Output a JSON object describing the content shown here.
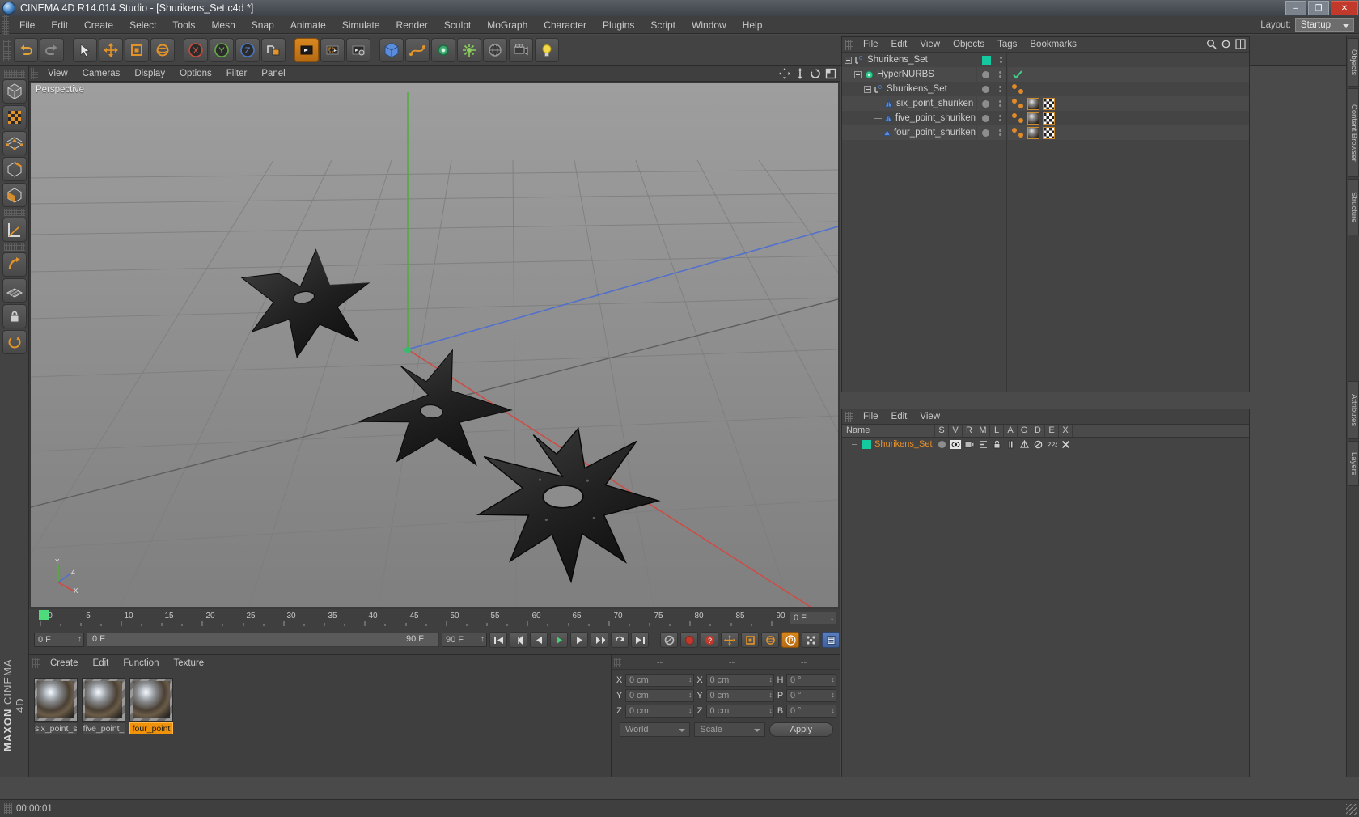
{
  "window": {
    "title": "CINEMA 4D R14.014 Studio - [Shurikens_Set.c4d *]",
    "app_icon": "c4d-logo-icon",
    "minimize": "–",
    "maximize": "❐",
    "close": "✕"
  },
  "menubar": {
    "items": [
      "File",
      "Edit",
      "Create",
      "Select",
      "Tools",
      "Mesh",
      "Snap",
      "Animate",
      "Simulate",
      "Render",
      "Sculpt",
      "MoGraph",
      "Character",
      "Plugins",
      "Script",
      "Window",
      "Help"
    ],
    "layout_label": "Layout:",
    "layout_value": "Startup"
  },
  "toolbar": {
    "buttons": [
      {
        "name": "undo-button",
        "icon": "undo-arrow-icon"
      },
      {
        "name": "redo-button",
        "icon": "redo-arrow-icon"
      },
      {
        "name": "live-selection-button",
        "icon": "cursor-arrow-icon"
      },
      {
        "name": "move-button",
        "icon": "move-cross-icon"
      },
      {
        "name": "scale-button",
        "icon": "scale-square-icon"
      },
      {
        "name": "rotate-button",
        "icon": "rotate-circle-icon"
      },
      {
        "name": "world-axis-button",
        "icon": "axis-cross-icon"
      },
      {
        "name": "lock-x-button",
        "icon": "x-axis-icon",
        "label": "X"
      },
      {
        "name": "lock-y-button",
        "icon": "y-axis-icon",
        "label": "Y"
      },
      {
        "name": "lock-z-button",
        "icon": "z-axis-icon",
        "label": "Z"
      },
      {
        "name": "world-coordinate-button",
        "icon": "world-coordinate-icon"
      },
      {
        "name": "render-view-button",
        "icon": "render-view-icon"
      },
      {
        "name": "render-region-button",
        "icon": "render-region-icon"
      },
      {
        "name": "render-settings-button",
        "icon": "render-settings-icon"
      },
      {
        "name": "add-cube-button",
        "icon": "cube-icon"
      },
      {
        "name": "add-spline-button",
        "icon": "spline-icon"
      },
      {
        "name": "add-generator-button",
        "icon": "generator-icon"
      },
      {
        "name": "add-deformer-button",
        "icon": "deformer-icon"
      },
      {
        "name": "add-scene-button",
        "icon": "environment-icon"
      },
      {
        "name": "add-camera-button",
        "icon": "camera-icon"
      },
      {
        "name": "add-light-button",
        "icon": "light-bulb-icon"
      }
    ]
  },
  "left_palette": {
    "buttons": [
      {
        "name": "model-mode-button",
        "icon": "model-cube-icon"
      },
      {
        "name": "texture-mode-button",
        "icon": "texture-checker-icon"
      },
      {
        "name": "points-mode-button",
        "icon": "points-mesh-icon"
      },
      {
        "name": "edges-mode-button",
        "icon": "edges-cube-icon"
      },
      {
        "name": "polygons-mode-button",
        "icon": "polygon-cube-icon"
      },
      {
        "name": "axis-mode-button",
        "icon": "axis-angle-icon"
      },
      {
        "name": "enable-axis-button",
        "icon": "axis-modify-icon"
      },
      {
        "name": "viewport-solo-button",
        "icon": "grid-icon"
      },
      {
        "name": "lock-workplane-button",
        "icon": "lock-icon"
      },
      {
        "name": "workplane-button",
        "icon": "workplane-rotate-icon"
      }
    ],
    "brand_top": "MAXON",
    "brand_bottom": "CINEMA 4D"
  },
  "viewport": {
    "menu": [
      "View",
      "Cameras",
      "Display",
      "Options",
      "Filter",
      "Panel"
    ],
    "label": "Perspective",
    "axis_gizmo": {
      "y": "Y",
      "z": "Z",
      "x": "X"
    },
    "corner_icons": [
      "pan-icon",
      "zoom-icon",
      "rotate-icon",
      "maximize-view-icon"
    ]
  },
  "timeline": {
    "ticks": [
      "0",
      "5",
      "10",
      "15",
      "20",
      "25",
      "30",
      "35",
      "40",
      "45",
      "50",
      "55",
      "60",
      "65",
      "70",
      "75",
      "80",
      "85",
      "90"
    ],
    "current_frame_marker": "0",
    "frame_field": "0 F",
    "start_field": "0 F",
    "end_field": "90 F",
    "preview_start": "0 F",
    "preview_end": "90 F",
    "transport": [
      {
        "name": "go-to-start-button",
        "icon": "skip-back-icon"
      },
      {
        "name": "previous-key-button",
        "icon": "prev-key-icon"
      },
      {
        "name": "step-back-button",
        "icon": "step-back-icon"
      },
      {
        "name": "play-button",
        "icon": "play-icon"
      },
      {
        "name": "step-forward-button",
        "icon": "step-forward-icon"
      },
      {
        "name": "next-key-button",
        "icon": "next-key-icon"
      },
      {
        "name": "go-to-end-button",
        "icon": "skip-forward-icon"
      }
    ],
    "record_tools": [
      {
        "name": "record-active-objects-button",
        "icon": "record-circle-icon"
      },
      {
        "name": "autokeying-button",
        "icon": "autokey-icon"
      },
      {
        "name": "keyframe-selection-button",
        "icon": "key-help-icon"
      },
      {
        "name": "position-key-button",
        "icon": "position-key-icon"
      },
      {
        "name": "scale-key-button",
        "icon": "scale-key-icon"
      },
      {
        "name": "rotation-key-button",
        "icon": "rotation-key-icon"
      },
      {
        "name": "parameter-key-button",
        "icon": "param-key-icon"
      },
      {
        "name": "point-level-animation-button",
        "icon": "pla-icon"
      },
      {
        "name": "timeline-options-button",
        "icon": "timeline-menu-icon"
      }
    ]
  },
  "material_manager": {
    "menu": [
      "Create",
      "Edit",
      "Function",
      "Texture"
    ],
    "materials": [
      {
        "name": "six_point_s",
        "selected": false
      },
      {
        "name": "five_point_",
        "selected": false
      },
      {
        "name": "four_point",
        "selected": true
      }
    ]
  },
  "coordinates": {
    "headers": [
      "--",
      "--",
      "--"
    ],
    "position": [
      {
        "label": "X",
        "value": "0 cm"
      },
      {
        "label": "Y",
        "value": "0 cm"
      },
      {
        "label": "Z",
        "value": "0 cm"
      }
    ],
    "size": [
      {
        "label": "X",
        "value": "0 cm"
      },
      {
        "label": "Y",
        "value": "0 cm"
      },
      {
        "label": "Z",
        "value": "0 cm"
      }
    ],
    "rotation": [
      {
        "label": "H",
        "value": "0 °"
      },
      {
        "label": "P",
        "value": "0 °"
      },
      {
        "label": "B",
        "value": "0 °"
      }
    ],
    "system": "World",
    "mode": "Scale",
    "apply_label": "Apply"
  },
  "object_manager": {
    "menu": [
      "File",
      "Edit",
      "View",
      "Objects",
      "Tags",
      "Bookmarks"
    ],
    "tools": [
      "search-icon",
      "filter-icon",
      "layout-icon"
    ],
    "rows": [
      {
        "name": "Shurikens_Set",
        "type": "null-object-icon",
        "depth": 0,
        "expander": true,
        "swatch": "#14c9a0",
        "check": false,
        "tags": []
      },
      {
        "name": "HyperNURBS",
        "type": "hypernurbs-icon",
        "depth": 1,
        "expander": true,
        "swatch": null,
        "check": true,
        "tags": []
      },
      {
        "name": "Shurikens_Set",
        "type": "null-object-icon",
        "depth": 2,
        "expander": true,
        "swatch": null,
        "check": false,
        "tags": [
          "dot",
          "dot"
        ]
      },
      {
        "name": "six_point_shuriken",
        "type": "polygon-object-icon",
        "depth": 3,
        "expander": false,
        "swatch": null,
        "check": false,
        "tags": [
          "dot",
          "dot",
          "material",
          "uv"
        ]
      },
      {
        "name": "five_point_shuriken",
        "type": "polygon-object-icon",
        "depth": 3,
        "expander": false,
        "swatch": null,
        "check": false,
        "tags": [
          "dot",
          "dot",
          "material",
          "uv"
        ]
      },
      {
        "name": "four_point_shuriken",
        "type": "polygon-object-icon",
        "depth": 3,
        "expander": false,
        "swatch": null,
        "check": false,
        "tags": [
          "dot",
          "dot",
          "material",
          "uv"
        ]
      }
    ]
  },
  "layer_manager": {
    "menu": [
      "File",
      "Edit",
      "View"
    ],
    "columns": [
      "Name",
      "S",
      "V",
      "R",
      "M",
      "L",
      "A",
      "G",
      "D",
      "E",
      "X"
    ],
    "rows": [
      {
        "name": "Shurikens_Set",
        "color": "#14c9a0",
        "text_color": "#e8902a",
        "cells": [
          "solo-dot-icon",
          "view-icon",
          "render-icon",
          "manager-icon",
          "lock-icon",
          "animation-icon",
          "generator-icon",
          "deformer-icon",
          "expression-icon",
          "xref-icon"
        ]
      }
    ]
  },
  "right_dock": {
    "tabs": [
      "Objects",
      "Content Browser",
      "Structure",
      "Attributes",
      "Layers"
    ]
  },
  "status_bar": {
    "text": "00:00:01"
  }
}
